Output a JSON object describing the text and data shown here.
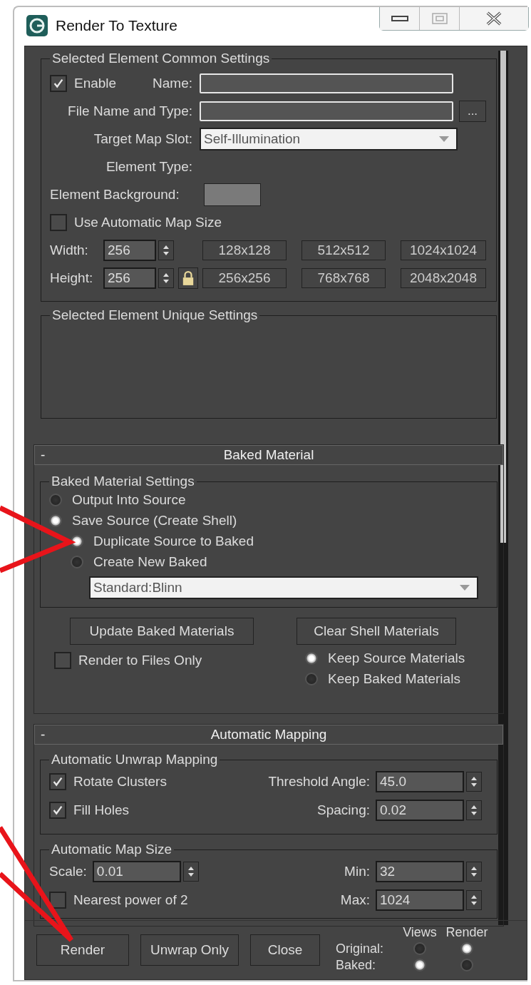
{
  "window": {
    "title": "Render To Texture"
  },
  "common_settings": {
    "title": "Selected Element Common Settings",
    "enable": {
      "label": "Enable",
      "checked": true
    },
    "name_label": "Name:",
    "file_label": "File Name and Type:",
    "browse": "...",
    "target_label": "Target Map Slot:",
    "target_value": "Self-Illumination",
    "element_type_label": "Element Type:",
    "background_label": "Element Background:",
    "auto_size": {
      "label": "Use Automatic Map Size",
      "checked": false
    },
    "width_label": "Width:",
    "width_value": "256",
    "height_label": "Height:",
    "height_value": "256",
    "presets": [
      "128x128",
      "512x512",
      "1024x1024",
      "256x256",
      "768x768",
      "2048x2048"
    ]
  },
  "unique_settings": {
    "title": "Selected Element Unique Settings"
  },
  "baked_material": {
    "collapse": "-",
    "header": "Baked Material",
    "group_title": "Baked Material Settings",
    "options": [
      {
        "label": "Output Into Source",
        "selected": false
      },
      {
        "label": "Save Source (Create Shell)",
        "selected": true,
        "children": [
          {
            "label": "Duplicate Source to Baked",
            "selected": true
          },
          {
            "label": "Create New Baked",
            "selected": false
          }
        ]
      }
    ],
    "material": "Standard:Blinn",
    "buttons": [
      "Update Baked Materials",
      "Clear Shell Materials"
    ],
    "render_to_files": {
      "label": "Render to Files Only",
      "checked": false
    },
    "keep": [
      {
        "label": "Keep Source Materials",
        "selected": true
      },
      {
        "label": "Keep Baked Materials",
        "selected": false
      }
    ]
  },
  "automatic_mapping": {
    "collapse": "-",
    "header": "Automatic Mapping",
    "unwrap": {
      "title": "Automatic Unwrap Mapping",
      "rotate": {
        "label": "Rotate Clusters",
        "checked": true
      },
      "fill": {
        "label": "Fill Holes",
        "checked": true
      },
      "threshold_label": "Threshold Angle:",
      "threshold_value": "45.0",
      "spacing_label": "Spacing:",
      "spacing_value": "0.02"
    },
    "map_size": {
      "title": "Automatic Map Size",
      "scale_label": "Scale:",
      "scale_value": "0.01",
      "nearest": {
        "label": "Nearest power of 2",
        "checked": false
      },
      "min_label": "Min:",
      "min_value": "32",
      "max_label": "Max:",
      "max_value": "1024"
    }
  },
  "bottom": {
    "buttons": [
      "Render",
      "Unwrap Only",
      "Close"
    ],
    "views_label": "Views",
    "render_label": "Render",
    "rows": [
      {
        "label": "Original:",
        "views_selected": false,
        "render_selected": true
      },
      {
        "label": "Baked:",
        "views_selected": true,
        "render_selected": false
      }
    ]
  }
}
